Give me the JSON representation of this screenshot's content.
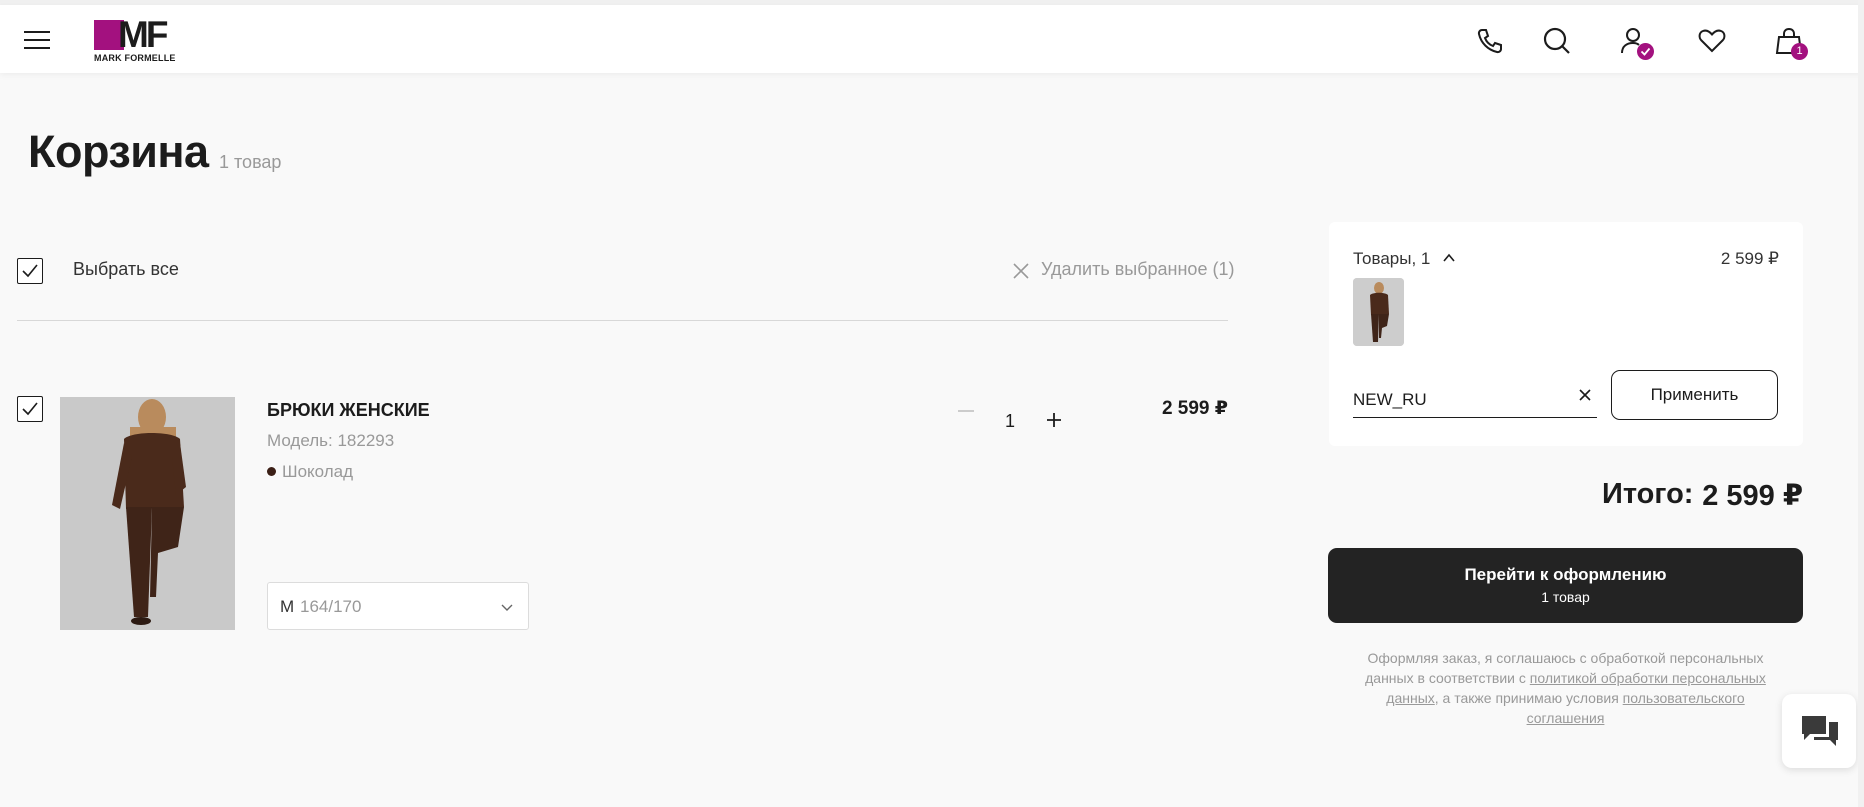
{
  "colors": {
    "brand": "#a3117f",
    "text": "#1c1c1c",
    "muted": "#999999",
    "button_dark": "#232323",
    "product_color_dot": "#3b1f16"
  },
  "header": {
    "logo_text": "MF",
    "logo_subtext": "MARK FORMELLE",
    "icons": [
      "menu-icon",
      "phone-icon",
      "search-icon",
      "account-icon",
      "heart-icon",
      "bag-icon"
    ],
    "cart_badge": "1"
  },
  "page": {
    "title": "Корзина",
    "count": "1 товар"
  },
  "cart": {
    "select_all_label": "Выбрать все",
    "delete_selected_label": "Удалить выбранное (1)",
    "items": [
      {
        "name": "БРЮКИ ЖЕНСКИЕ",
        "model": "Модель: 182293",
        "color": "Шоколад",
        "quantity": "1",
        "price": "2 599 ₽",
        "size_letter": "M",
        "size_value": "164/170"
      }
    ]
  },
  "summary": {
    "items_label": "Товары, 1",
    "items_price": "2 599 ₽",
    "promo_value": "NEW_RU",
    "apply_label": "Применить",
    "total_label": "Итого:",
    "total_value": "2 599 ₽",
    "checkout_label": "Перейти к оформлению",
    "checkout_sublabel": "1 товар",
    "legal_text_1": "Оформляя заказ, я соглашаюсь с обработкой персональных данных в соответствии с ",
    "legal_link_1": "политикой обработки персональных данных",
    "legal_text_2": ", а также принимаю условия ",
    "legal_link_2": "пользовательского соглашения"
  }
}
